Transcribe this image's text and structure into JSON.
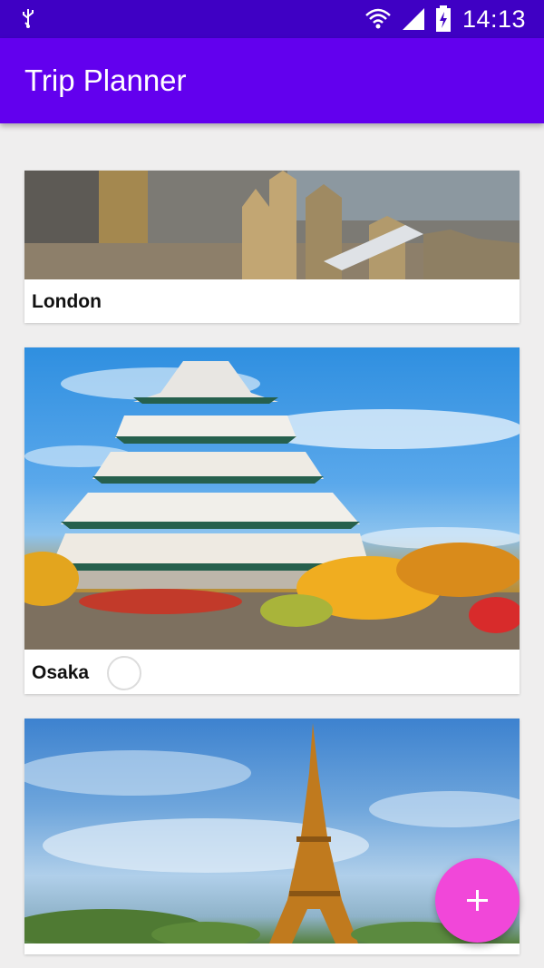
{
  "status_bar": {
    "time": "14:13",
    "icons": [
      "usb-icon",
      "wifi-icon",
      "cell-signal-icon",
      "battery-charging-icon"
    ]
  },
  "app_bar": {
    "title": "Trip Planner"
  },
  "trips": [
    {
      "name": "London",
      "image": "london-photo"
    },
    {
      "name": "Osaka",
      "image": "osaka-castle-photo",
      "loading": true
    },
    {
      "name": "",
      "image": "eiffel-tower-photo"
    }
  ],
  "fab": {
    "icon": "plus-icon"
  },
  "colors": {
    "status_bar": "#3f00c4",
    "app_bar": "#6200ee",
    "fab": "#f147d9",
    "background": "#efeeee"
  }
}
